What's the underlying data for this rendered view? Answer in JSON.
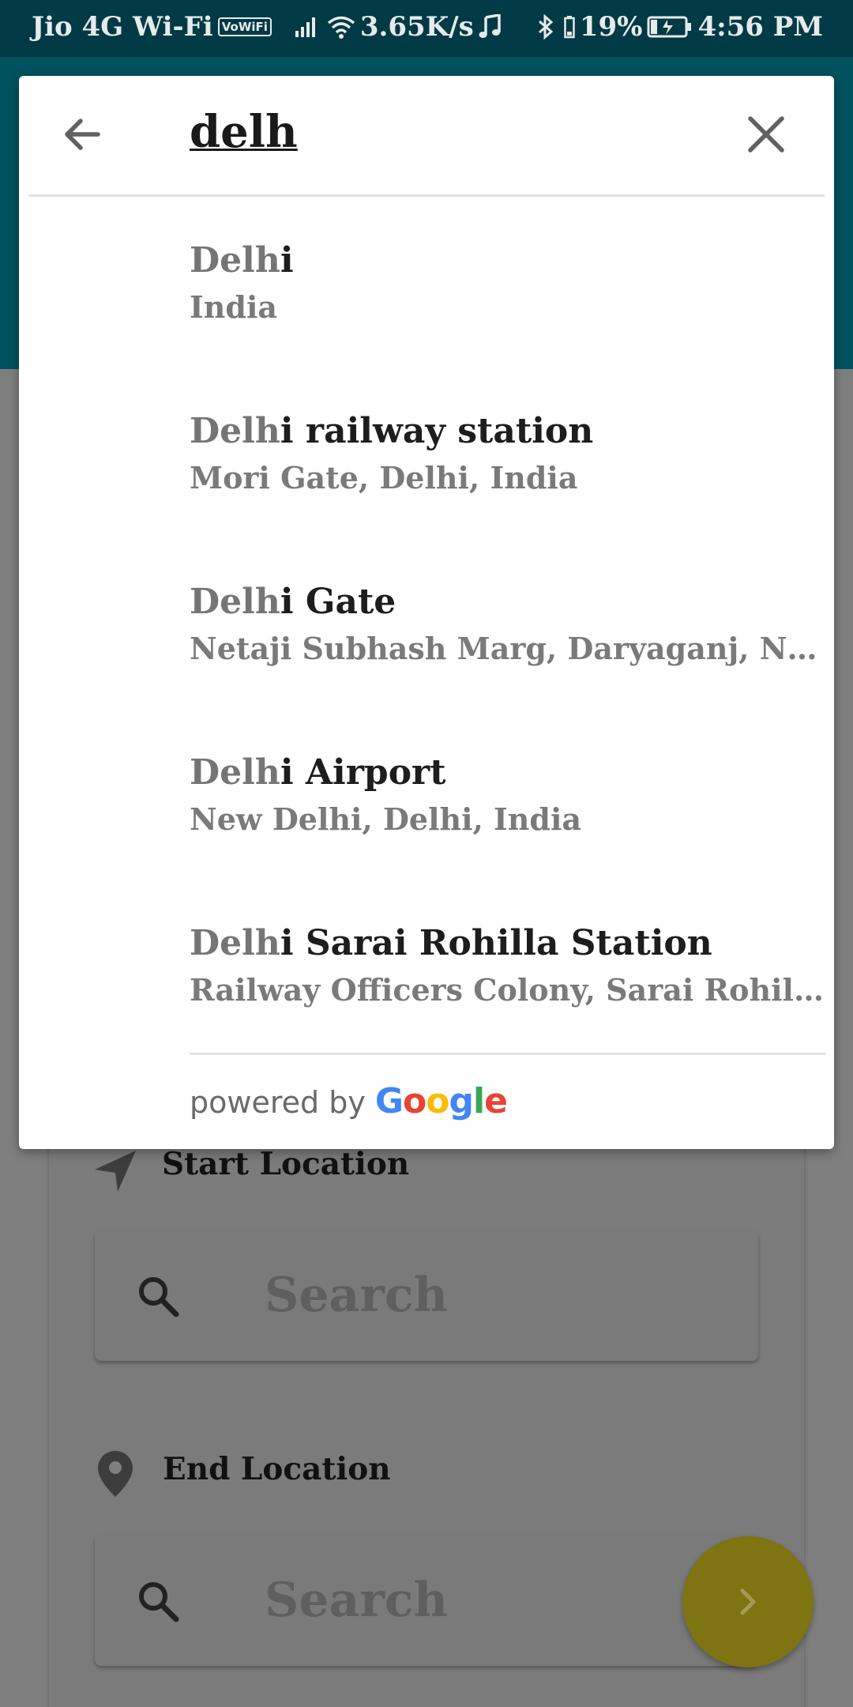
{
  "status_bar": {
    "carrier": "Jio 4G Wi-Fi",
    "vowifi": "VoWiFi",
    "speed": "3.65K/s",
    "battery": "19%",
    "time": "4:56 PM"
  },
  "autocomplete": {
    "query": "delh",
    "results": [
      {
        "match": "Delh",
        "rest": "i",
        "subtitle": "India"
      },
      {
        "match": "Delh",
        "rest": "i railway station",
        "subtitle": "Mori Gate, Delhi, India"
      },
      {
        "match": "Delh",
        "rest": "i Gate",
        "subtitle": "Netaji Subhash Marg, Daryaganj, New Delhi, Delhi, India"
      },
      {
        "match": "Delh",
        "rest": "i Airport",
        "subtitle": "New Delhi, Delhi, India"
      },
      {
        "match": "Delh",
        "rest": "i Sarai Rohilla Station",
        "subtitle": "Railway Officers Colony, Sarai Rohilla, New Delhi, Delhi, India"
      }
    ],
    "powered_by": "powered by",
    "google_letters": [
      "G",
      "o",
      "o",
      "g",
      "l",
      "e"
    ],
    "google_colors": [
      "#4285F4",
      "#EA4335",
      "#FBBC05",
      "#4285F4",
      "#34A853",
      "#EA4335"
    ]
  },
  "form": {
    "start_label": "Start Location",
    "start_placeholder": "Search",
    "end_label": "End Location",
    "end_placeholder": "Search"
  },
  "colors": {
    "status_bar": "#003a44",
    "header_teal_dimmed": "#00525e",
    "fab_dimmed": "#7e7411"
  }
}
